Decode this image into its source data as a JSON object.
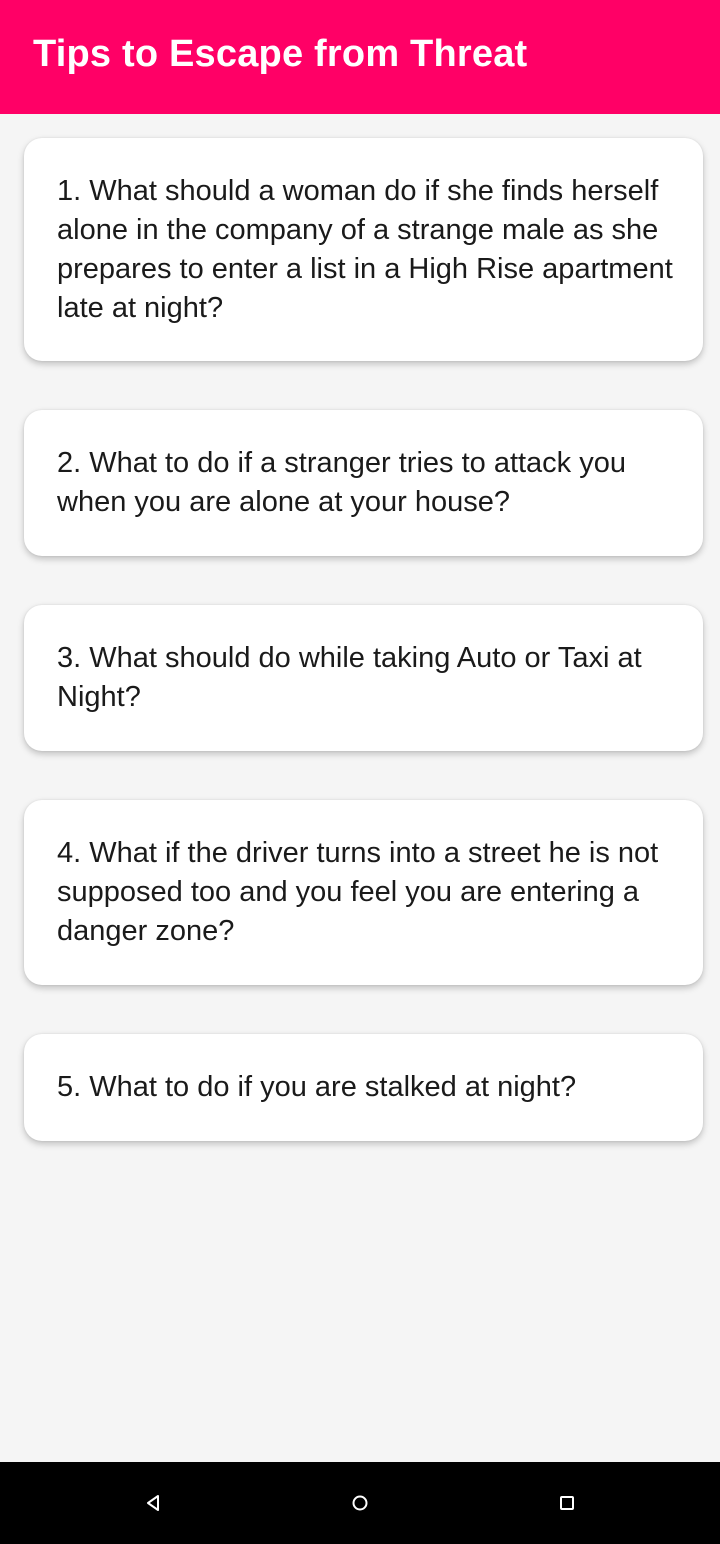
{
  "app_bar": {
    "title": "Tips to Escape from Threat",
    "color": "#FF0066"
  },
  "tips": [
    {
      "text": "1. What should a woman do if she finds herself alone in the company of a strange male as she prepares to enter a list in a High Rise apartment late at night?"
    },
    {
      "text": "2. What to do if a stranger tries to attack you when you are alone at your house?"
    },
    {
      "text": "3. What should do while taking Auto or Taxi at Night?"
    },
    {
      "text": "4. What if the driver turns into a street he is not supposed too and you feel you are entering a danger zone?"
    },
    {
      "text": "5. What to do if you are stalked at night?"
    }
  ],
  "nav_bar": {
    "icons": [
      "back-triangle-icon",
      "home-circle-icon",
      "recents-square-icon"
    ]
  }
}
